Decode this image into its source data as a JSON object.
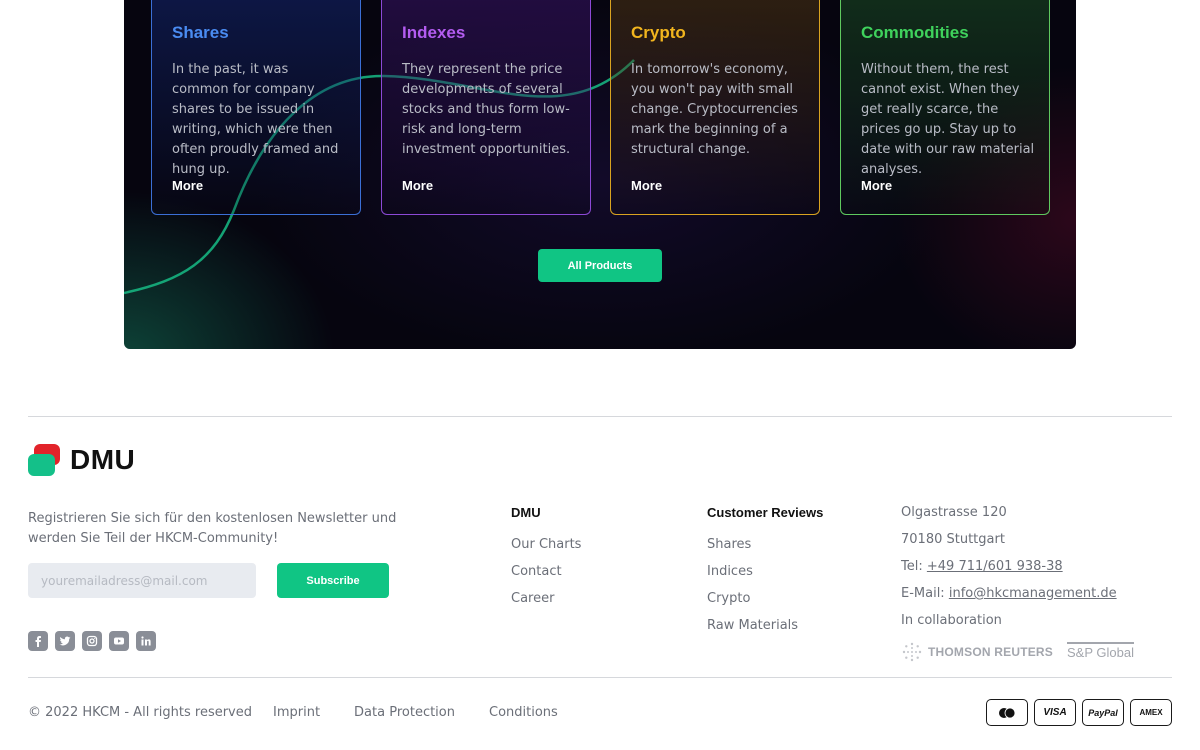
{
  "products": [
    {
      "key": "shares",
      "title": "Shares",
      "text": "In the past, it was common for company shares to be issued in writing, which were then often proudly framed and hung up.",
      "more": "More",
      "color": "#4a8cf2"
    },
    {
      "key": "indexes",
      "title": "Indexes",
      "text": "They represent the price developments of several stocks and thus form low-risk and long-term investment opportunities.",
      "more": "More",
      "color": "#b35cf0"
    },
    {
      "key": "crypto",
      "title": "Crypto",
      "text": "In tomorrow's economy, you won't pay with small change. Cryptocurrencies mark the beginning of a structural change.",
      "more": "More",
      "color": "#f2b51e"
    },
    {
      "key": "commodities",
      "title": "Commodities",
      "text": "Without them, the rest cannot exist. When they get really scarce, the prices go up. Stay up to date with our raw material analyses.",
      "more": "More",
      "color": "#3fd25c"
    }
  ],
  "all_products_label": "All Products",
  "footer": {
    "brand": "DMU",
    "newsletter_text": "Registrieren Sie sich für den kostenlosen Newsletter und werden Sie Teil der HKCM-Community!",
    "email_placeholder": "youremailadress@mail.com",
    "subscribe_label": "Subscribe",
    "social_icons": [
      "facebook-icon",
      "twitter-icon",
      "instagram-icon",
      "youtube-icon",
      "linkedin-icon"
    ],
    "col_dmu": {
      "heading": "DMU",
      "links": [
        "Our Charts",
        "Contact",
        "Career"
      ]
    },
    "col_reviews": {
      "heading": "Customer Reviews",
      "links": [
        "Shares",
        "Indices",
        "Crypto",
        "Raw Materials"
      ]
    },
    "address": {
      "street": "Olgastrasse 120",
      "city": "70180 Stuttgart",
      "tel_label": "Tel:",
      "tel": "+49 711/601 938-38",
      "email_label": "E-Mail:",
      "email": "info@hkcmanagement.de",
      "collab": "In collaboration"
    },
    "partners": {
      "thomson": "THOMSON REUTERS",
      "sp": "S&P Global"
    },
    "copyright": "© 2022 HKCM - All rights reserved",
    "bottom_links": [
      "Imprint",
      "Data Protection",
      "Conditions"
    ],
    "payments": {
      "visa": "VISA",
      "paypal": "PayPal",
      "amex": "AMEX"
    }
  },
  "colors": {
    "accent": "#10c584",
    "panel_bg": "#06050f"
  }
}
